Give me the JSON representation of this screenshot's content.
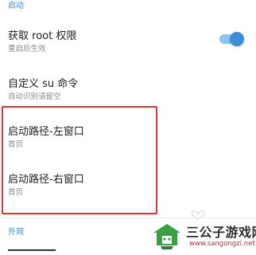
{
  "sections": {
    "startup_header": "启动",
    "appearance_header": "外观"
  },
  "settings": {
    "root": {
      "title": "获取 root 权限",
      "subtitle": "重启后生效",
      "enabled": true
    },
    "su_cmd": {
      "title": "自定义 su 命令",
      "subtitle": "自动识别请留空"
    },
    "left_path": {
      "title": "启动路径-左窗口",
      "subtitle": "首页"
    },
    "right_path": {
      "title": "启动路径-右窗口",
      "subtitle": "首页"
    }
  },
  "watermark": {
    "name": "三公子游戏网",
    "url": "www.sangongzi.net"
  },
  "colors": {
    "accent": "#3d8ed6",
    "highlight": "#e23232"
  }
}
